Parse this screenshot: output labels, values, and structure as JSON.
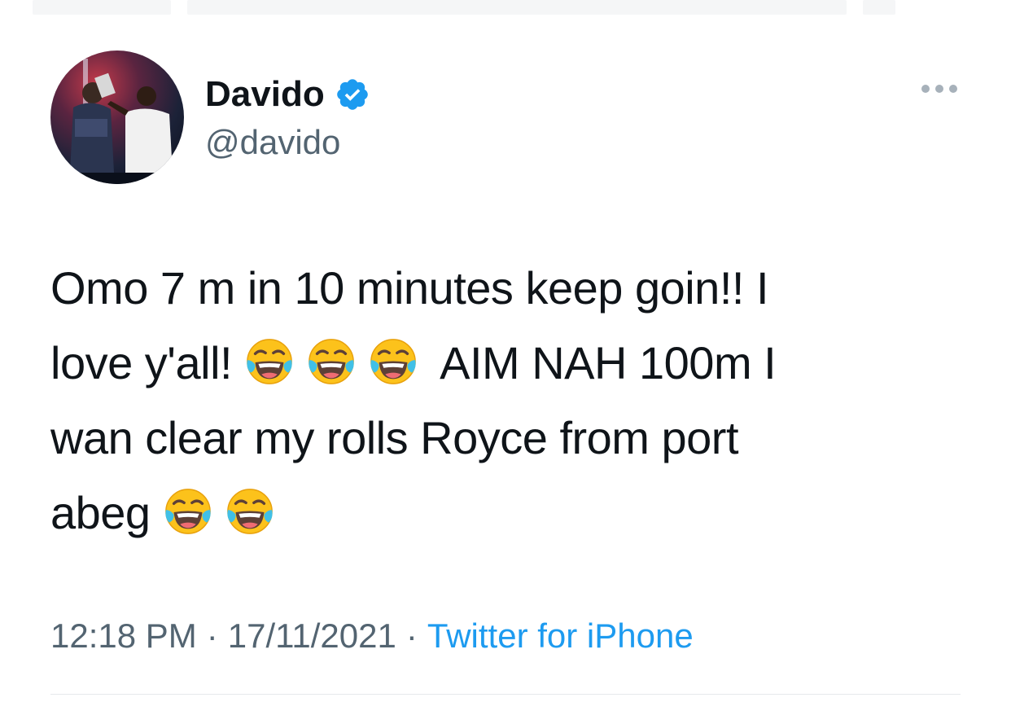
{
  "user": {
    "display_name": "Davido",
    "handle": "@davido",
    "verified": true
  },
  "tweet": {
    "lines": [
      [
        "Omo 7 m in 10 minutes keep goin!! I"
      ],
      [
        "love y'all! ",
        "face-with-tears-of-joy",
        "face-with-tears-of-joy",
        "face-with-tears-of-joy",
        " AIM NAH 100m I"
      ],
      [
        "wan clear my rolls Royce from port"
      ],
      [
        "abeg ",
        "face-with-tears-of-joy",
        "face-with-tears-of-joy"
      ]
    ]
  },
  "meta": {
    "time": "12:18 PM",
    "separator": "·",
    "date": "17/11/2021",
    "source": "Twitter for iPhone"
  },
  "colors": {
    "text": "#0f1419",
    "secondary": "#536471",
    "link": "#1d9bf0",
    "verified": "#1d9bf0"
  },
  "icons": {
    "verified": "verified-badge-icon",
    "more": "more-options-icon",
    "emoji": "face-with-tears-of-joy"
  }
}
